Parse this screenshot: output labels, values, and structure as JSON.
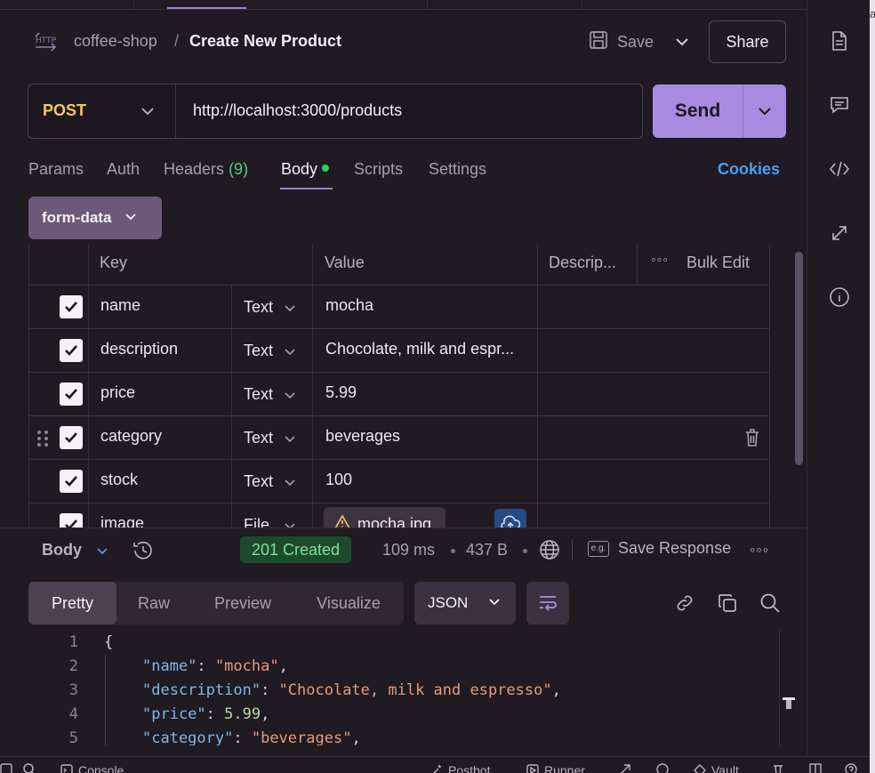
{
  "header": {
    "workspace": "coffee-shop",
    "separator": "/",
    "title": "Create New Product",
    "save_label": "Save",
    "share_label": "Share"
  },
  "request": {
    "method": "POST",
    "url": "http://localhost:3000/products",
    "send_label": "Send"
  },
  "tabs": {
    "params": "Params",
    "auth": "Auth",
    "headers": "Headers",
    "headers_count": "(9)",
    "body": "Body",
    "scripts": "Scripts",
    "settings": "Settings",
    "cookies": "Cookies"
  },
  "body_mode": "form-data",
  "table": {
    "headers": {
      "key": "Key",
      "value": "Value",
      "description": "Descrip...",
      "bulk_edit": "Bulk Edit"
    },
    "rows": [
      {
        "key": "name",
        "type": "Text",
        "value": "mocha"
      },
      {
        "key": "description",
        "type": "Text",
        "value": "Chocolate, milk and espr..."
      },
      {
        "key": "price",
        "type": "Text",
        "value": "5.99"
      },
      {
        "key": "category",
        "type": "Text",
        "value": "beverages"
      },
      {
        "key": "stock",
        "type": "Text",
        "value": "100"
      },
      {
        "key": "image",
        "type": "File",
        "value": "mocha.jpg"
      }
    ]
  },
  "response": {
    "section_label": "Body",
    "status": "201 Created",
    "time": "109 ms",
    "size": "437 B",
    "save_response": "Save Response",
    "eg_label": "e.g.",
    "view_tabs": {
      "pretty": "Pretty",
      "raw": "Raw",
      "preview": "Preview",
      "visualize": "Visualize"
    },
    "format": "JSON",
    "code_lines": [
      {
        "num": "1",
        "key": "",
        "value": "",
        "open": "{"
      },
      {
        "num": "2",
        "key": "\"name\"",
        "value": "\"mocha\""
      },
      {
        "num": "3",
        "key": "\"description\"",
        "value": "\"Chocolate, milk and espresso\""
      },
      {
        "num": "4",
        "key": "\"price\"",
        "value": "5.99"
      },
      {
        "num": "5",
        "key": "\"category\"",
        "value": "\"beverages\""
      }
    ]
  },
  "statusbar": {
    "console": "Console",
    "postbot": "Postbot",
    "runner": "Runner",
    "vault": "Vault"
  },
  "colors": {
    "accent": "#a88be0",
    "method": "#f2c863",
    "status_ok": "#7ee29b",
    "link": "#4d9df0"
  },
  "icons": {
    "http": "http-request-icon",
    "save": "floppy-disk-icon",
    "rail": [
      "document-icon",
      "comment-icon",
      "code-icon",
      "arrows-icon",
      "info-icon"
    ]
  }
}
